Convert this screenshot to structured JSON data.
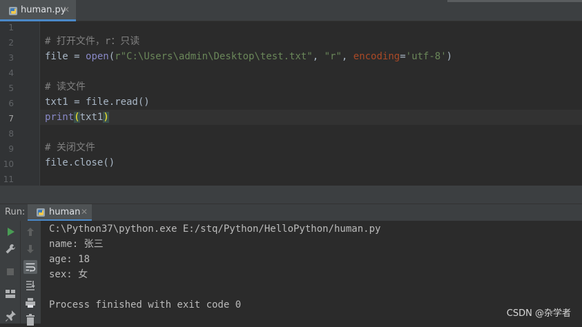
{
  "editor_tab": {
    "filename": "human.py",
    "close": "✕"
  },
  "editor": {
    "line_numbers": [
      "1",
      "2",
      "3",
      "4",
      "5",
      "6",
      "7",
      "8",
      "9",
      "10",
      "11"
    ],
    "current_line": "7",
    "lines": {
      "l2_comment": "# 打开文件，r：只读",
      "l3_var": "file",
      "l3_eq": " = ",
      "l3_open": "open",
      "l3_paren_open": "(",
      "l3_path": "r\"C:\\Users\\admin\\Desktop\\test.txt\"",
      "l3_comma1": ", ",
      "l3_mode": "\"r\"",
      "l3_comma2": ", ",
      "l3_kw": "encoding",
      "l3_kw_eq": "=",
      "l3_enc": "'utf-8'",
      "l3_paren_close": ")",
      "l5_comment": "# 读文件",
      "l6_code": "txt1 = file.read()",
      "l7_print": "print",
      "l7_paren_open": "(",
      "l7_arg": "txt1",
      "l7_paren_close": ")",
      "l9_comment": "# 关闭文件",
      "l10_code": "file.close()"
    }
  },
  "run_panel": {
    "label": "Run:",
    "tab_name": "human",
    "close": "✕",
    "output": [
      "C:\\Python37\\python.exe E:/stq/Python/HelloPython/human.py",
      "name: 张三",
      "age: 18",
      "sex: 女",
      "",
      "Process finished with exit code 0"
    ]
  },
  "watermark": "CSDN @杂学者",
  "colors": {
    "accent": "#4a88c7",
    "run_green": "#499c54",
    "bracket_match": "#ffef28"
  }
}
